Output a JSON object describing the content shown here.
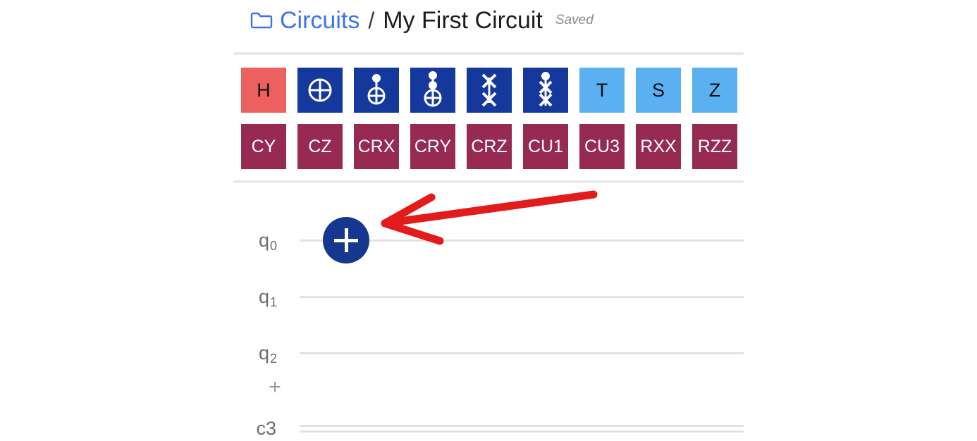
{
  "header": {
    "folder_icon": "folder-icon",
    "breadcrumb_root": "Circuits",
    "separator": "/",
    "circuit_name": "My First Circuit",
    "save_status": "Saved",
    "link_color": "#3b74e8",
    "status_color": "#8b8b8b"
  },
  "palette": {
    "row1": [
      {
        "label": "H",
        "style": "h",
        "icon": "text"
      },
      {
        "label": "X",
        "style": "navy",
        "icon": "x-gate-circle-plus-icon"
      },
      {
        "label": "CX",
        "style": "navy",
        "icon": "cnot-icon"
      },
      {
        "label": "CCX",
        "style": "navy",
        "icon": "toffoli-icon"
      },
      {
        "label": "SWAP",
        "style": "navy",
        "icon": "swap-icon"
      },
      {
        "label": "CSWAP",
        "style": "navy",
        "icon": "cswap-icon"
      },
      {
        "label": "T",
        "style": "light",
        "icon": "text"
      },
      {
        "label": "S",
        "style": "light",
        "icon": "text"
      },
      {
        "label": "Z",
        "style": "light",
        "icon": "text"
      }
    ],
    "row2": [
      {
        "label": "CY",
        "style": "maroon",
        "icon": "text"
      },
      {
        "label": "CZ",
        "style": "maroon",
        "icon": "text"
      },
      {
        "label": "CRX",
        "style": "maroon",
        "icon": "text"
      },
      {
        "label": "CRY",
        "style": "maroon",
        "icon": "text"
      },
      {
        "label": "CRZ",
        "style": "maroon",
        "icon": "text"
      },
      {
        "label": "CU1",
        "style": "maroon",
        "icon": "text"
      },
      {
        "label": "CU3",
        "style": "maroon",
        "icon": "text"
      },
      {
        "label": "RXX",
        "style": "maroon",
        "icon": "text"
      },
      {
        "label": "RZZ",
        "style": "maroon",
        "icon": "text"
      }
    ],
    "colors": {
      "hadamard": "#ec6060",
      "navy": "#14389b",
      "light_blue": "#5bb0f2",
      "maroon": "#972a51"
    }
  },
  "circuit": {
    "registers": [
      {
        "name": "q",
        "index": "0",
        "type": "quantum"
      },
      {
        "name": "q",
        "index": "1",
        "type": "quantum"
      },
      {
        "name": "q",
        "index": "2",
        "type": "quantum"
      },
      {
        "name": "c3",
        "index": "",
        "type": "classical"
      }
    ],
    "add_qubit_label": "+",
    "add_gate_button": "+",
    "add_gate_color": "#16378f",
    "wire_color": "#e2e2e2"
  },
  "annotation": {
    "arrow_color": "#e21b1b",
    "points_at": "add-gate-button"
  }
}
